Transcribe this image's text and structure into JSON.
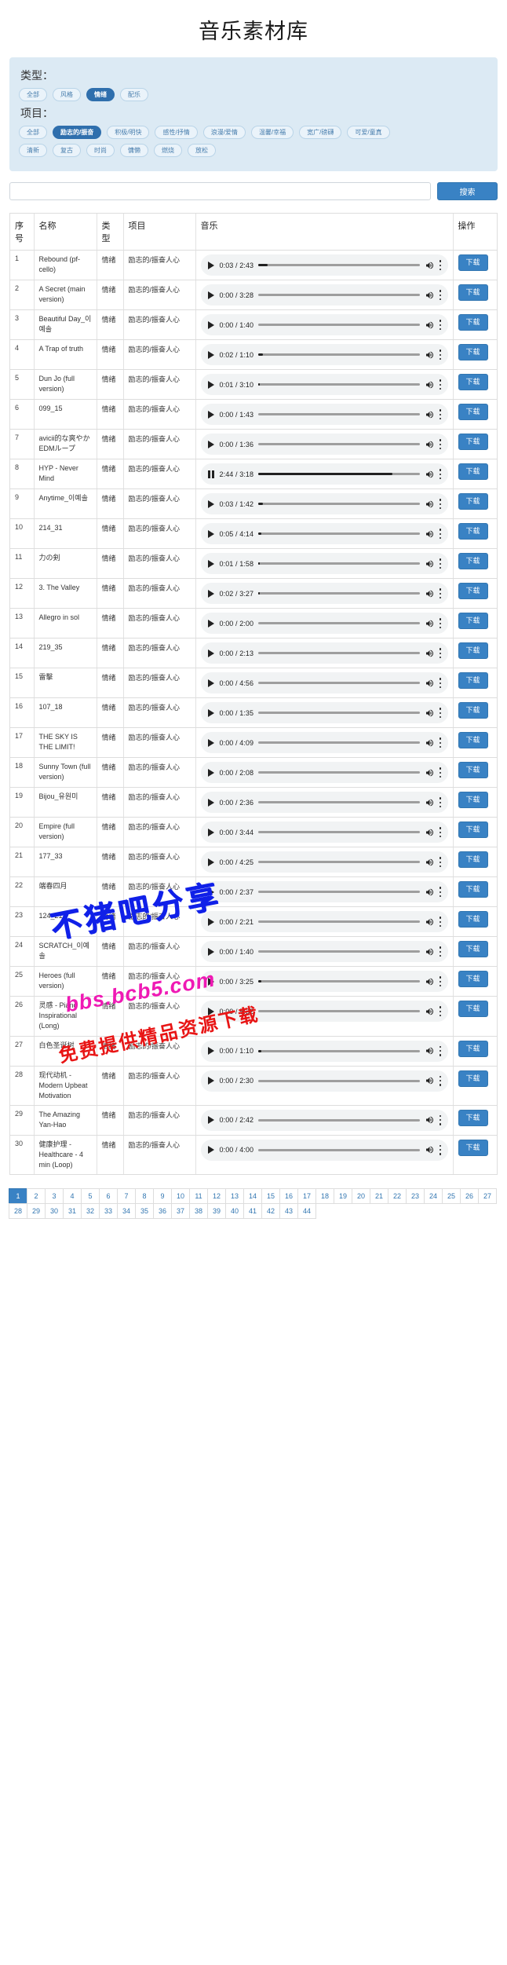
{
  "header": {
    "title": "音乐素材库"
  },
  "filters": {
    "type": {
      "label": "类型：",
      "tags": [
        "全部",
        "风格",
        "情绪",
        "配乐"
      ],
      "active": "情绪"
    },
    "project": {
      "label": "项目：",
      "tags_row1": [
        "全部",
        "励志的/振奋",
        "积极/明快",
        "感性/抒情",
        "浪漫/爱情",
        "温馨/幸福",
        "宽广/磅礴",
        "可爱/童真"
      ],
      "tags_row2": [
        "清新",
        "复古",
        "时尚",
        "慵懒",
        "燃烧",
        "放松"
      ],
      "active": "励志的/振奋"
    }
  },
  "search": {
    "value": "",
    "placeholder": "",
    "button_label": "搜索"
  },
  "table": {
    "headers": [
      "序号",
      "名称",
      "类型",
      "项目",
      "音乐",
      "操作"
    ],
    "download_label": "下载",
    "rows": [
      {
        "idx": "1",
        "name": "Rebound (pf-cello)",
        "type": "情绪",
        "project": "励志的/振奋人心",
        "current": "0:03",
        "duration": "2:43",
        "progress": 6,
        "state": "paused"
      },
      {
        "idx": "2",
        "name": "A Secret (main version)",
        "type": "情绪",
        "project": "励志的/振奋人心",
        "current": "0:00",
        "duration": "3:28",
        "progress": 0,
        "state": "paused"
      },
      {
        "idx": "3",
        "name": "Beautiful Day_이예솔",
        "type": "情绪",
        "project": "励志的/振奋人心",
        "current": "0:00",
        "duration": "1:40",
        "progress": 0,
        "state": "paused"
      },
      {
        "idx": "4",
        "name": "A Trap of truth",
        "type": "情绪",
        "project": "励志的/振奋人心",
        "current": "0:02",
        "duration": "1:10",
        "progress": 3,
        "state": "paused"
      },
      {
        "idx": "5",
        "name": "Dun Jo (full version)",
        "type": "情绪",
        "project": "励志的/振奋人心",
        "current": "0:01",
        "duration": "3:10",
        "progress": 1,
        "state": "paused"
      },
      {
        "idx": "6",
        "name": "099_15",
        "type": "情绪",
        "project": "励志的/振奋人心",
        "current": "0:00",
        "duration": "1:43",
        "progress": 0,
        "state": "paused"
      },
      {
        "idx": "7",
        "name": "avicii的な爽やかEDMループ",
        "type": "情绪",
        "project": "励志的/振奋人心",
        "current": "0:00",
        "duration": "1:36",
        "progress": 0,
        "state": "paused"
      },
      {
        "idx": "8",
        "name": "HYP - Never Mind",
        "type": "情绪",
        "project": "励志的/振奋人心",
        "current": "2:44",
        "duration": "3:18",
        "progress": 83,
        "state": "playing"
      },
      {
        "idx": "9",
        "name": "Anytime_이예솔",
        "type": "情绪",
        "project": "励志的/振奋人心",
        "current": "0:03",
        "duration": "1:42",
        "progress": 3,
        "state": "paused"
      },
      {
        "idx": "10",
        "name": "214_31",
        "type": "情绪",
        "project": "励志的/振奋人心",
        "current": "0:05",
        "duration": "4:14",
        "progress": 2,
        "state": "paused"
      },
      {
        "idx": "11",
        "name": "力の剣",
        "type": "情绪",
        "project": "励志的/振奋人心",
        "current": "0:01",
        "duration": "1:58",
        "progress": 1,
        "state": "paused"
      },
      {
        "idx": "12",
        "name": "3. The Valley",
        "type": "情绪",
        "project": "励志的/振奋人心",
        "current": "0:02",
        "duration": "3:27",
        "progress": 1,
        "state": "paused"
      },
      {
        "idx": "13",
        "name": "Allegro in sol",
        "type": "情绪",
        "project": "励志的/振奋人心",
        "current": "0:00",
        "duration": "2:00",
        "progress": 0,
        "state": "paused"
      },
      {
        "idx": "14",
        "name": "219_35",
        "type": "情绪",
        "project": "励志的/振奋人心",
        "current": "0:00",
        "duration": "2:13",
        "progress": 0,
        "state": "paused"
      },
      {
        "idx": "15",
        "name": "雷擊",
        "type": "情绪",
        "project": "励志的/振奋人心",
        "current": "0:00",
        "duration": "4:56",
        "progress": 0,
        "state": "paused"
      },
      {
        "idx": "16",
        "name": "107_18",
        "type": "情绪",
        "project": "励志的/振奋人心",
        "current": "0:00",
        "duration": "1:35",
        "progress": 0,
        "state": "paused"
      },
      {
        "idx": "17",
        "name": "THE SKY IS THE LIMIT!",
        "type": "情绪",
        "project": "励志的/振奋人心",
        "current": "0:00",
        "duration": "4:09",
        "progress": 0,
        "state": "paused"
      },
      {
        "idx": "18",
        "name": "Sunny Town (full version)",
        "type": "情绪",
        "project": "励志的/振奋人心",
        "current": "0:00",
        "duration": "2:08",
        "progress": 0,
        "state": "paused"
      },
      {
        "idx": "19",
        "name": "Bijou_유원미",
        "type": "情绪",
        "project": "励志的/振奋人心",
        "current": "0:00",
        "duration": "2:36",
        "progress": 0,
        "state": "paused"
      },
      {
        "idx": "20",
        "name": "Empire (full version)",
        "type": "情绪",
        "project": "励志的/振奋人心",
        "current": "0:00",
        "duration": "3:44",
        "progress": 0,
        "state": "paused"
      },
      {
        "idx": "21",
        "name": "177_33",
        "type": "情绪",
        "project": "励志的/振奋人心",
        "current": "0:00",
        "duration": "4:25",
        "progress": 0,
        "state": "paused"
      },
      {
        "idx": "22",
        "name": "端春四月",
        "type": "情绪",
        "project": "励志的/振奋人心",
        "current": "0:00",
        "duration": "2:37",
        "progress": 0,
        "state": "paused"
      },
      {
        "idx": "23",
        "name": "124_21",
        "type": "情绪",
        "project": "励志的/振奋人心",
        "current": "0:00",
        "duration": "2:21",
        "progress": 0,
        "state": "paused"
      },
      {
        "idx": "24",
        "name": "SCRATCH_이예솔",
        "type": "情绪",
        "project": "励志的/振奋人心",
        "current": "0:00",
        "duration": "1:40",
        "progress": 0,
        "state": "paused"
      },
      {
        "idx": "25",
        "name": "Heroes (full version)",
        "type": "情绪",
        "project": "励志的/振奋人心",
        "current": "0:00",
        "duration": "3:25",
        "progress": 2,
        "state": "paused"
      },
      {
        "idx": "26",
        "name": "灵感 - Piano Inspirational (Long)",
        "type": "情绪",
        "project": "励志的/振奋人心",
        "current": "0:00",
        "duration": "5:32",
        "progress": 0,
        "state": "paused"
      },
      {
        "idx": "27",
        "name": "白色圣诞树",
        "type": "情绪",
        "project": "励志的/振奋人心",
        "current": "0:00",
        "duration": "1:10",
        "progress": 2,
        "state": "paused"
      },
      {
        "idx": "28",
        "name": "现代动机 - Modern Upbeat Motivation",
        "type": "情绪",
        "project": "励志的/振奋人心",
        "current": "0:00",
        "duration": "2:30",
        "progress": 0,
        "state": "paused"
      },
      {
        "idx": "29",
        "name": "The Amazing Yan-Hao",
        "type": "情绪",
        "project": "励志的/振奋人心",
        "current": "0:00",
        "duration": "2:42",
        "progress": 0,
        "state": "paused"
      },
      {
        "idx": "30",
        "name": "健康护理 - Healthcare - 4 min (Loop)",
        "type": "情绪",
        "project": "励志的/振奋人心",
        "current": "0:00",
        "duration": "4:00",
        "progress": 0,
        "state": "paused"
      }
    ]
  },
  "pagination": {
    "pages": [
      "1",
      "2",
      "3",
      "4",
      "5",
      "6",
      "7",
      "8",
      "9",
      "10",
      "11",
      "12",
      "13",
      "14",
      "15",
      "16",
      "17",
      "18",
      "19",
      "20",
      "21",
      "22",
      "23",
      "24",
      "25",
      "26",
      "27",
      "28",
      "29",
      "30",
      "31",
      "32",
      "33",
      "34",
      "35",
      "36",
      "37",
      "38",
      "39",
      "40",
      "41",
      "42",
      "43",
      "44"
    ],
    "active": "1"
  },
  "watermarks": {
    "line1": "不猪吧分享",
    "line2": "bbs.bcb5.com",
    "line3": "免费提供精品资源下载"
  },
  "colors": {
    "accent": "#3982c4",
    "panel_bg": "#dceaf4",
    "tag_active": "#2f6fad",
    "watermark_blue": "#1020e8",
    "watermark_pink": "#ef19b4",
    "watermark_red": "#e81515"
  }
}
